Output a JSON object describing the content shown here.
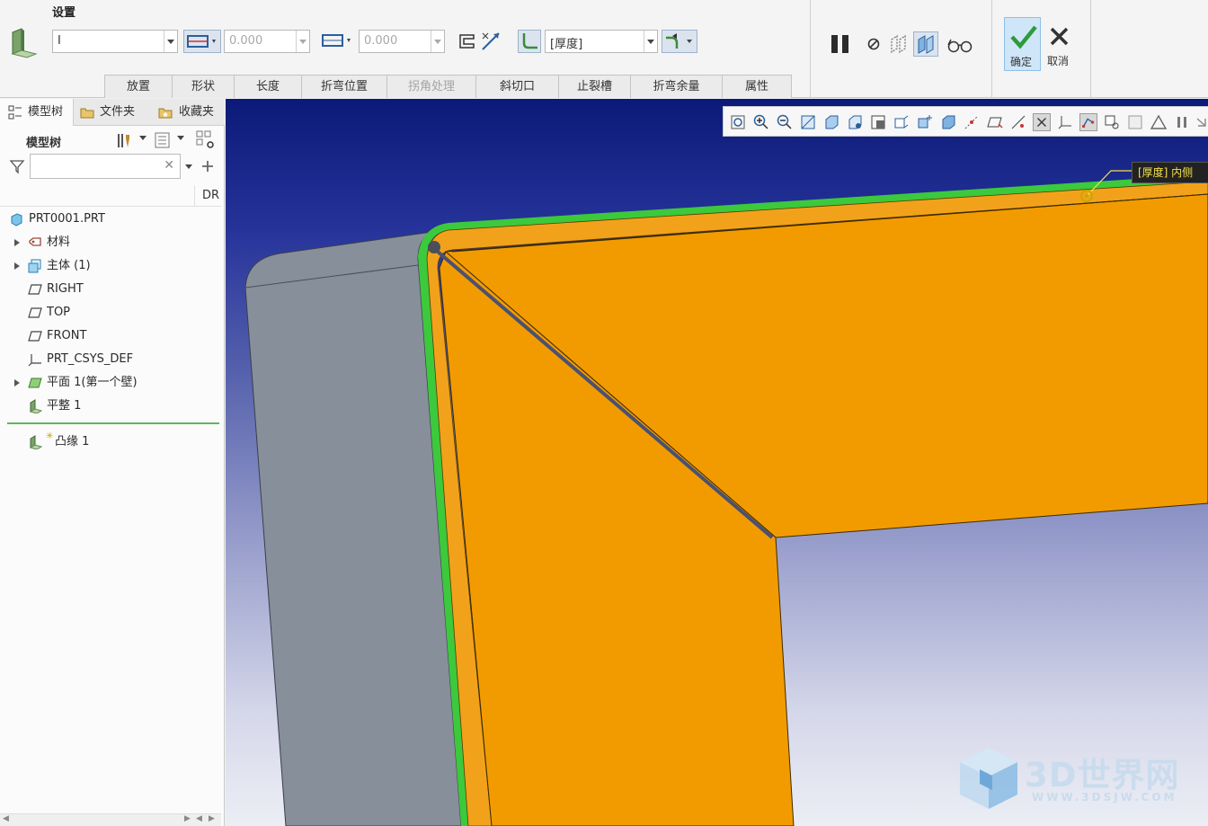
{
  "ribbon": {
    "group_title": "设置",
    "wall_attach_value": "I",
    "length1_value": "0.000",
    "length2_value": "0.000",
    "thickness_combo_value": "[厚度]",
    "tabs": [
      "放置",
      "形状",
      "长度",
      "折弯位置",
      "拐角处理",
      "斜切口",
      "止裂槽",
      "折弯余量",
      "属性"
    ],
    "ok_label": "确定",
    "cancel_label": "取消"
  },
  "left_panel": {
    "tabs": [
      "模型树",
      "文件夹",
      "收藏夹"
    ],
    "tree_title": "模型树",
    "search_placeholder": "",
    "column_header": "DR",
    "nodes": [
      {
        "label": "PRT0001.PRT",
        "expandable": false
      },
      {
        "label": "材料",
        "expandable": true
      },
      {
        "label": "主体 (1)",
        "expandable": true
      },
      {
        "label": "RIGHT",
        "expandable": false
      },
      {
        "label": "TOP",
        "expandable": false
      },
      {
        "label": "FRONT",
        "expandable": false
      },
      {
        "label": "PRT_CSYS_DEF",
        "expandable": false
      },
      {
        "label": "平面 1(第一个壁)",
        "expandable": true
      },
      {
        "label": "平整 1",
        "expandable": false
      },
      {
        "label": "凸缘 1",
        "expandable": false
      }
    ]
  },
  "graphics": {
    "dimension_tag": "[厚度] 内侧",
    "watermark_main": "3D世界网",
    "watermark_sub": "WWW.3DSJW.COM"
  },
  "colors": {
    "accent_orange": "#f29b00",
    "edge_green": "#3cc93c",
    "grey_wall": "#878f9b",
    "bg_top": "#0b1a78",
    "bg_bottom": "#eceef5",
    "ok_button": "#cfe6f8"
  },
  "icons": {
    "ok": "check-icon",
    "cancel": "close-icon",
    "pause": "pause-icon",
    "feature": "flange-wall-icon"
  }
}
